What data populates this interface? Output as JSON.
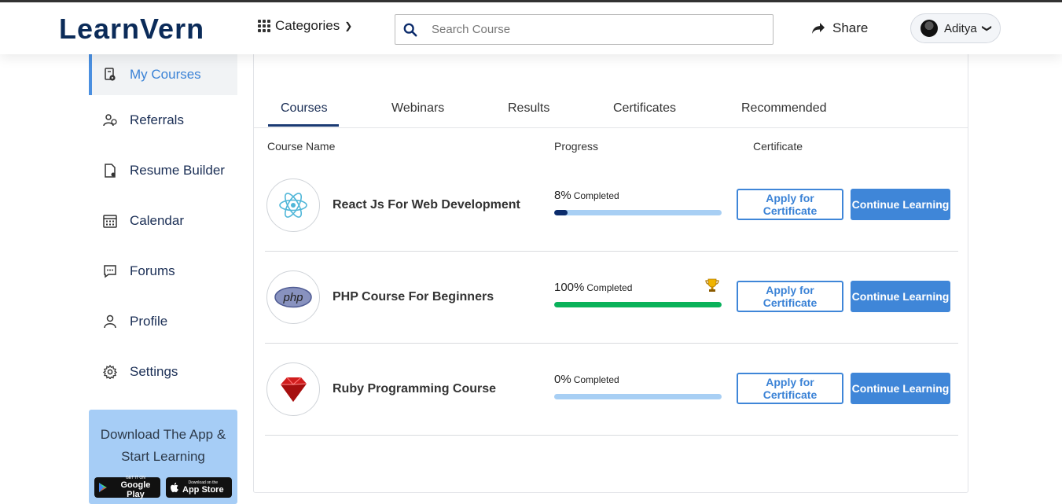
{
  "header": {
    "logo": "LearnVern",
    "categories_label": "Categories",
    "search_placeholder": "Search Course",
    "share_label": "Share",
    "user_name": "Aditya"
  },
  "sidebar": {
    "items": [
      {
        "label": "My Courses",
        "icon": "courses-icon",
        "active": true
      },
      {
        "label": "Referrals",
        "icon": "referrals-icon"
      },
      {
        "label": "Resume Builder",
        "icon": "resume-icon"
      },
      {
        "label": "Calendar",
        "icon": "calendar-icon"
      },
      {
        "label": "Forums",
        "icon": "forums-icon"
      },
      {
        "label": "Profile",
        "icon": "profile-icon"
      },
      {
        "label": "Settings",
        "icon": "settings-icon"
      }
    ],
    "app_promo": {
      "line1": "Download The App &",
      "line2": "Start Learning",
      "google_play_small": "GET IT ON",
      "google_play": "Google Play",
      "app_store_small": "Download on the",
      "app_store": "App Store"
    }
  },
  "main": {
    "tabs": [
      {
        "label": "Courses",
        "active": true
      },
      {
        "label": "Webinars"
      },
      {
        "label": "Results"
      },
      {
        "label": "Certificates"
      },
      {
        "label": "Recommended"
      }
    ],
    "columns": {
      "course_name": "Course Name",
      "progress": "Progress",
      "certificate": "Certificate"
    },
    "courses": [
      {
        "name": "React Js For Web Development",
        "progress_value": "8%",
        "progress_label": "Completed",
        "progress_fraction": 0.08,
        "bar_color": "#0b2b6b",
        "icon": "react-logo-icon",
        "trophy": false,
        "apply_label": "Apply for Certificate",
        "continue_label": "Continue Learning"
      },
      {
        "name": "PHP Course For Beginners",
        "progress_value": "100%",
        "progress_label": "Completed",
        "progress_fraction": 1.0,
        "bar_color": "#0ab25a",
        "icon": "php-logo-icon",
        "trophy": true,
        "apply_label": "Apply for Certificate",
        "continue_label": "Continue Learning"
      },
      {
        "name": "Ruby Programming Course",
        "progress_value": "0%",
        "progress_label": "Completed",
        "progress_fraction": 0.0,
        "bar_color": "#0b2b6b",
        "icon": "ruby-logo-icon",
        "trophy": false,
        "apply_label": "Apply for Certificate",
        "continue_label": "Continue Learning"
      }
    ]
  },
  "colors": {
    "brand_navy": "#0b2b59",
    "accent_blue": "#3f86d8",
    "complete_green": "#0ab25a",
    "bar_track": "#a8cff4"
  }
}
